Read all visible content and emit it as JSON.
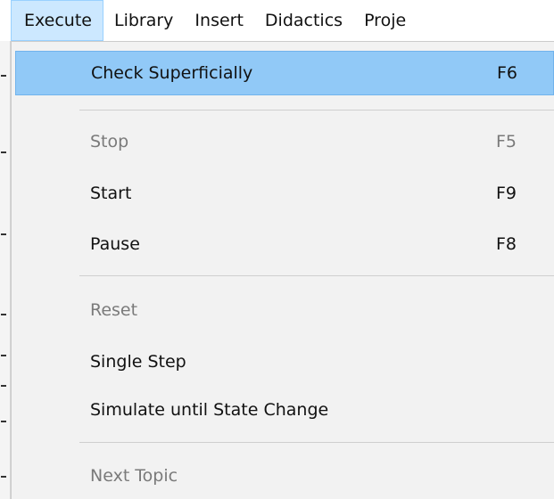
{
  "menubar": {
    "items": [
      {
        "label": "Execute",
        "active": true
      },
      {
        "label": "Library",
        "active": false
      },
      {
        "label": "Insert",
        "active": false
      },
      {
        "label": "Didactics",
        "active": false
      },
      {
        "label": "Proje",
        "active": false
      }
    ]
  },
  "dropdown": {
    "items": [
      {
        "label": "Check Superficially",
        "shortcut": "F6",
        "enabled": true,
        "highlighted": true
      },
      {
        "label": "Stop",
        "shortcut": "F5",
        "enabled": false
      },
      {
        "label": "Start",
        "shortcut": "F9",
        "enabled": true
      },
      {
        "label": "Pause",
        "shortcut": "F8",
        "enabled": true
      },
      {
        "label": "Reset",
        "shortcut": "",
        "enabled": false
      },
      {
        "label": "Single Step",
        "shortcut": "",
        "enabled": true
      },
      {
        "label": "Simulate until State Change",
        "shortcut": "",
        "enabled": true
      },
      {
        "label": "Next Topic",
        "shortcut": "",
        "enabled": false
      }
    ]
  },
  "colors": {
    "highlight": "#91c9f7",
    "active_menu": "#cce8ff",
    "menu_background": "#f2f2f2",
    "disabled_text": "#7a7a7a"
  }
}
